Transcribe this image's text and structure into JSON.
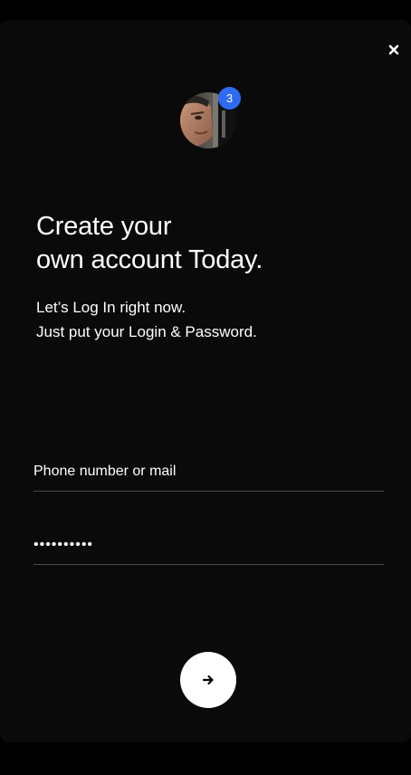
{
  "badge": {
    "count": "3",
    "color": "#2f6bf2"
  },
  "headline": {
    "line1": "Create your",
    "line2": "own account Today."
  },
  "subtext": {
    "line1": "Let’s Log In right now.",
    "line2": "Just put your Login & Password."
  },
  "form": {
    "phone": {
      "placeholder": "Phone number or mail",
      "value": ""
    },
    "password": {
      "value": "••••••••••"
    }
  },
  "icons": {
    "close": "close-icon",
    "submit": "arrow-right-icon"
  },
  "colors": {
    "background": "#0a0a0a",
    "text": "#ffffff",
    "divider": "#4a4a4a",
    "button": "#ffffff"
  }
}
